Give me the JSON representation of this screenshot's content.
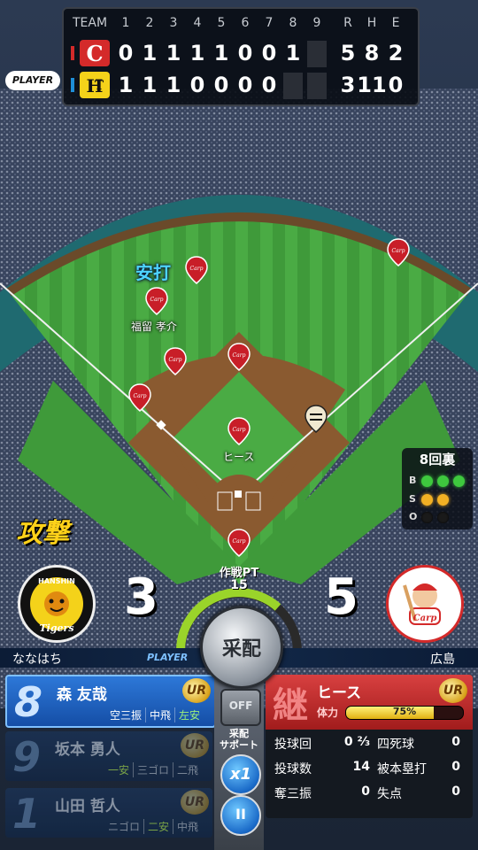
{
  "scoreboard": {
    "headers": [
      "TEAM",
      "1",
      "2",
      "3",
      "4",
      "5",
      "6",
      "7",
      "8",
      "9",
      "R",
      "H",
      "E"
    ],
    "away": {
      "innings": [
        "0",
        "1",
        "1",
        "1",
        "1",
        "0",
        "0",
        "1",
        ""
      ],
      "r": "5",
      "h": "8",
      "e": "2",
      "color": "#d42a2a"
    },
    "home": {
      "innings": [
        "1",
        "1",
        "1",
        "0",
        "0",
        "0",
        "0",
        "",
        ""
      ],
      "r": "3",
      "h": "11",
      "e": "0",
      "color": "#1e8fd8"
    },
    "player_tag": "PLAYER"
  },
  "field": {
    "hit_text": "安打",
    "fielder1_name": "福留 孝介",
    "pitcher_name": "ヒース"
  },
  "inning": {
    "title": "8回裏",
    "labels": [
      "B",
      "S",
      "O"
    ],
    "balls": 3,
    "strikes": 2,
    "outs": 0,
    "ball_color": "#3ec83e",
    "strike_color": "#f2b024"
  },
  "scores": {
    "attack_label": "攻撃",
    "home_score": "3",
    "away_score": "5",
    "tactic_label": "作戦PT",
    "tactic_value": "15",
    "hanshin_text": "HANSHIN",
    "tigers_text": "Tigers",
    "carp_text": "Carp"
  },
  "namebar": {
    "left_name": "ななはち",
    "player_tag": "PLAYER",
    "right_name": "広島"
  },
  "batters": [
    {
      "order": "8",
      "name": "森 友哉",
      "stats": [
        "空三振",
        "中飛",
        "左安"
      ],
      "rarity": "UR",
      "active": true
    },
    {
      "order": "9",
      "name": "坂本 勇人",
      "stats": [
        "一安",
        "三ゴロ",
        "二飛"
      ],
      "rarity": "UR",
      "active": false
    },
    {
      "order": "1",
      "name": "山田 哲人",
      "stats": [
        "ニゴロ",
        "二安",
        "中飛"
      ],
      "rarity": "UR",
      "active": false
    }
  ],
  "pitcher": {
    "badge": "継",
    "name": "ヒース",
    "stamina_label": "体力",
    "stamina_text": "75%",
    "stamina_pct": 75,
    "rarity": "UR",
    "rows": [
      {
        "l1": "投球回",
        "v1": "0 ⅔",
        "l2": "四死球",
        "v2": "0"
      },
      {
        "l1": "投球数",
        "v1": "14",
        "l2": "被本塁打",
        "v2": "0"
      },
      {
        "l1": "奪三振",
        "v1": "0",
        "l2": "失点",
        "v2": "0"
      }
    ]
  },
  "controls": {
    "saihai_label": "采配",
    "off_label": "OFF",
    "support_label1": "采配",
    "support_label2": "サポート",
    "speed_label": "x1",
    "pause_label": "II"
  }
}
